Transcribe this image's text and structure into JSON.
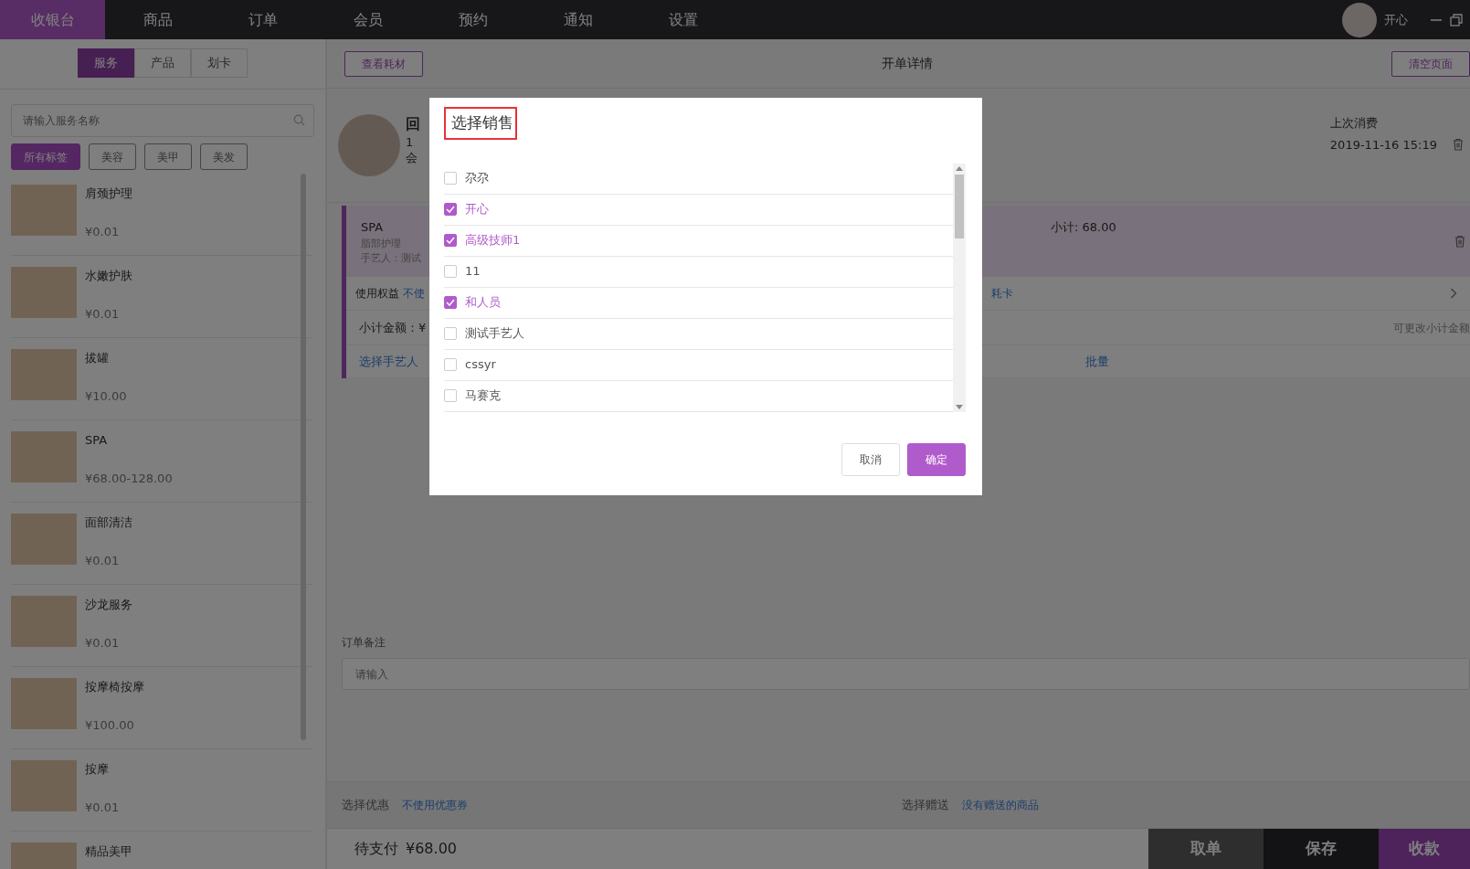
{
  "nav": {
    "tabs": [
      {
        "label": "收银台",
        "selected": true
      },
      {
        "label": "商品",
        "selected": false
      },
      {
        "label": "订单",
        "selected": false
      },
      {
        "label": "会员",
        "selected": false
      },
      {
        "label": "预约",
        "selected": false
      },
      {
        "label": "通知",
        "selected": false
      },
      {
        "label": "设置",
        "selected": false
      }
    ],
    "user_name": "开心"
  },
  "catalog": {
    "segments": [
      {
        "label": "服务",
        "selected": true
      },
      {
        "label": "产品",
        "selected": false
      },
      {
        "label": "划卡",
        "selected": false
      }
    ],
    "search": {
      "placeholder": "请输入服务名称"
    },
    "tags": [
      {
        "label": "所有标签",
        "selected": true
      },
      {
        "label": "美容",
        "selected": false
      },
      {
        "label": "美甲",
        "selected": false
      },
      {
        "label": "美发",
        "selected": false
      }
    ],
    "items": [
      {
        "name": "肩颈护理",
        "price": "¥0.01"
      },
      {
        "name": "水嫩护肤",
        "price": "¥0.01"
      },
      {
        "name": "拔罐",
        "price": "¥10.00"
      },
      {
        "name": "SPA",
        "price": "¥68.00-128.00"
      },
      {
        "name": "面部清洁",
        "price": "¥0.01"
      },
      {
        "name": "沙龙服务",
        "price": "¥0.01"
      },
      {
        "name": "按摩椅按摩",
        "price": "¥100.00"
      },
      {
        "name": "按摩",
        "price": "¥0.01"
      },
      {
        "name": "精品美甲"
      }
    ]
  },
  "header": {
    "materials_button": "查看耗材",
    "title": "开单详情",
    "clear_button": "清空页面"
  },
  "customer": {
    "name": "回",
    "line_2": "1",
    "line_3": "会",
    "last_visit_label": "上次消费",
    "last_visit_time": "2019-11-16 15:19"
  },
  "order_item": {
    "name": "SPA",
    "category": "脂部护理",
    "artisan": "手艺人：测试",
    "subtotal": "小计: 68.00",
    "benefit_label": "使用权益",
    "benefit_value": "不使",
    "card_link": "耗卡",
    "amount_label": "小计金额：¥",
    "amount_hint": "可更改小计金额",
    "choose_artisan": "选择手艺人",
    "batch": "批量"
  },
  "remark": {
    "label": "订单备注",
    "placeholder": "请输入"
  },
  "extras": {
    "discount_label": "选择优惠",
    "discount_value": "不使用优惠券",
    "gift_label": "选择赠送",
    "gift_value": "没有赠送的商品"
  },
  "footer": {
    "due_label": "待支付",
    "due_amount": "¥68.00",
    "buttons": [
      {
        "label": "取单",
        "kind": "grey"
      },
      {
        "label": "保存",
        "kind": "black"
      },
      {
        "label": "收款",
        "kind": "purple"
      }
    ]
  },
  "dialog": {
    "title": "选择销售",
    "options": [
      {
        "label": "尕尕",
        "checked": false
      },
      {
        "label": "开心",
        "checked": true
      },
      {
        "label": "高级技师1",
        "checked": true
      },
      {
        "label": "11",
        "checked": false
      },
      {
        "label": "和人员",
        "checked": true
      },
      {
        "label": "测试手艺人",
        "checked": false
      },
      {
        "label": "cssyr",
        "checked": false
      },
      {
        "label": "马赛克",
        "checked": false
      }
    ],
    "buttons": [
      {
        "label": "取消",
        "kind": "cancel"
      },
      {
        "label": "确定",
        "kind": "confirm"
      }
    ]
  }
}
